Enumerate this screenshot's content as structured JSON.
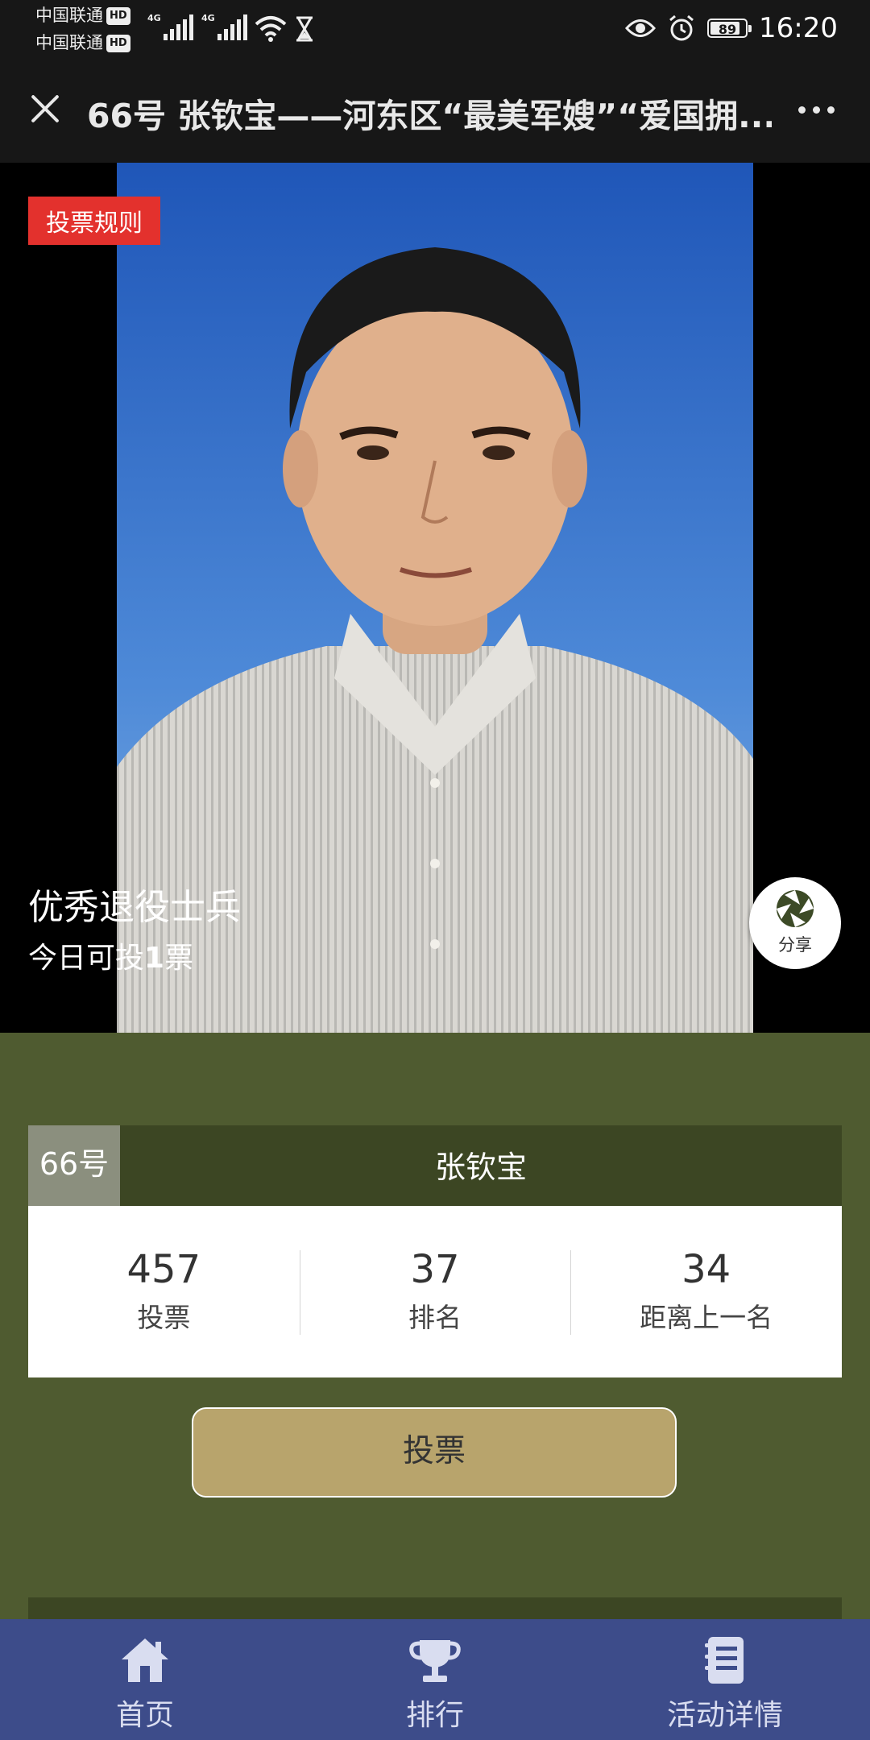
{
  "status_bar": {
    "carrier_1": "中国联通",
    "carrier_2": "中国联通",
    "hd": "HD",
    "network_1": "4G",
    "network_2": "4G",
    "battery": "89",
    "time": "16:20"
  },
  "title_bar": {
    "title": "66号 张钦宝——河东区“最美军嫂”“爱国拥..."
  },
  "hero": {
    "rules_label": "投票规则",
    "category": "优秀退役士兵",
    "today_prefix": "今日可投",
    "today_count": "1",
    "today_suffix": "票",
    "share_label": "分享"
  },
  "candidate": {
    "number": "66号",
    "name": "张钦宝"
  },
  "stats": [
    {
      "value": "457",
      "label": "投票"
    },
    {
      "value": "37",
      "label": "排名"
    },
    {
      "value": "34",
      "label": "距离上一名"
    }
  ],
  "vote_button": "投票",
  "nav": [
    {
      "label": "首页",
      "icon": "home-icon"
    },
    {
      "label": "排行",
      "icon": "trophy-icon"
    },
    {
      "label": "活动详情",
      "icon": "notebook-icon"
    }
  ],
  "colors": {
    "page_bg": "#4f5b30",
    "card_head": "#3c4623",
    "number_bg": "#8b8f7e",
    "vote_button": "#b8a46c",
    "rules_badge": "#e3312d",
    "nav_bg": "#3d4c8a"
  }
}
